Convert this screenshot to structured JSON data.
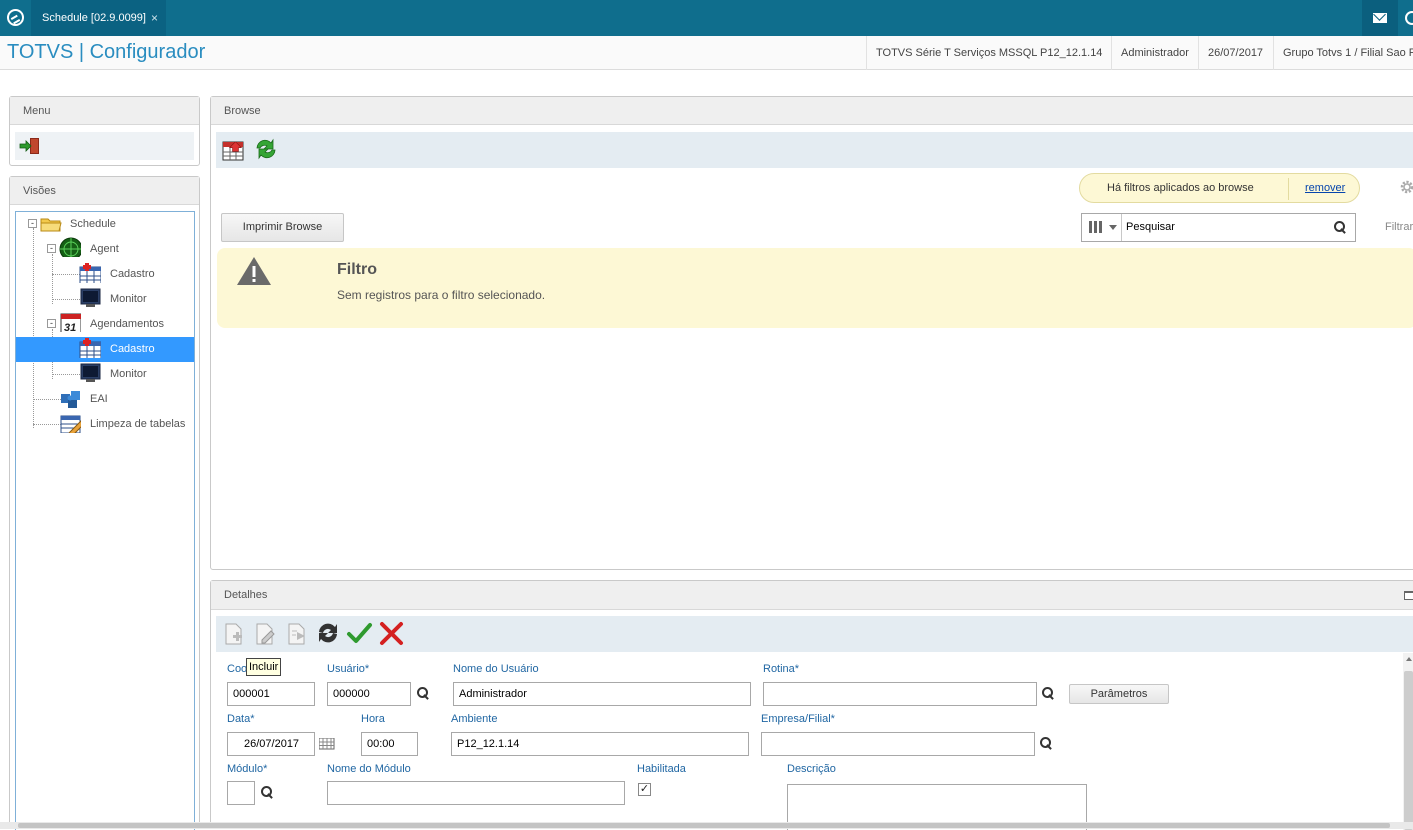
{
  "window": {
    "tab_title": "Schedule [02.9.0099]",
    "tab_close": "×"
  },
  "header": {
    "app_title": "TOTVS | Configurador",
    "environment": "TOTVS Série T Serviços MSSQL P12_12.1.14",
    "user": "Administrador",
    "date": "26/07/2017",
    "company": "Grupo Totvs 1 / Filial Sao Pa"
  },
  "menu": {
    "title": "Menu"
  },
  "views": {
    "title": "Visões",
    "tree": [
      {
        "label": "Schedule"
      },
      {
        "label": "Agent"
      },
      {
        "label": "Cadastro"
      },
      {
        "label": "Monitor"
      },
      {
        "label": "Agendamentos"
      },
      {
        "label": "Cadastro",
        "selected": true
      },
      {
        "label": "Monitor"
      },
      {
        "label": "EAI"
      },
      {
        "label": "Limpeza de tabelas"
      }
    ]
  },
  "browse": {
    "title": "Browse",
    "filter_notice": "Há filtros aplicados ao browse",
    "remove_link": "remover",
    "print_button": "Imprimir Browse",
    "search_value": "Pesquisar",
    "filter_label": "Filtrar",
    "alert_title": "Filtro",
    "alert_message": "Sem registros para o filtro selecionado."
  },
  "details": {
    "title": "Detalhes",
    "tooltip": "Incluir",
    "fields": {
      "code_label": "Coo",
      "code_value": "000001",
      "user_label": "Usuário*",
      "user_value": "000000",
      "user_name_label": "Nome do Usuário",
      "user_name_value": "Administrador",
      "routine_label": "Rotina*",
      "routine_value": "",
      "params_button": "Parâmetros",
      "date_label": "Data*",
      "date_value": "26/07/2017",
      "time_label": "Hora",
      "time_value": "00:00",
      "env_label": "Ambiente",
      "env_value": "P12_12.1.14",
      "company_label": "Empresa/Filial*",
      "company_value": "",
      "module_label": "Módulo*",
      "module_value": "",
      "module_name_label": "Nome do Módulo",
      "module_name_value": "",
      "enabled_label": "Habilitada",
      "enabled_check": "✓",
      "description_label": "Descrição",
      "description_value": ""
    }
  },
  "colors": {
    "topbar": "#0f6e8d",
    "accent": "#2a8dc0",
    "selected": "#3399ff",
    "label": "#2167a3"
  }
}
